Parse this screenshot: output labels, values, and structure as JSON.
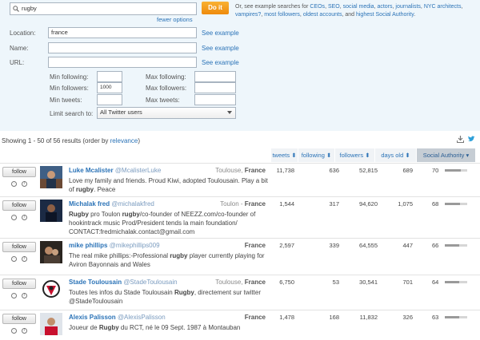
{
  "search": {
    "query": "rugby",
    "do_it_label": "Do it",
    "fewer_options": "fewer options",
    "help_prefix": "Or, see example searches for ",
    "help_links": [
      "CEOs",
      "SEO",
      "social media",
      "actors",
      "journalists",
      "NYC architects",
      "vampires?",
      "most followers",
      "oldest accounts"
    ],
    "help_and": "and ",
    "help_last": "highest Social Authority",
    "help_suffix": "."
  },
  "filters": {
    "location_label": "Location:",
    "location_value": "france",
    "name_label": "Name:",
    "url_label": "URL:",
    "see_example": "See example",
    "min_following_label": "Min following:",
    "max_following_label": "Max following:",
    "min_followers_label": "Min followers:",
    "min_followers_value": "1000",
    "max_followers_label": "Max followers:",
    "min_tweets_label": "Min tweets:",
    "max_tweets_label": "Max tweets:",
    "limit_label": "Limit search to:",
    "limit_value": "All Twitter users"
  },
  "results": {
    "summary_prefix": "Showing 1 - 50 of 56 results (order by ",
    "order_by": "relevance",
    "summary_suffix": ")",
    "columns": [
      "tweets",
      "following",
      "followers",
      "days old",
      "Social Authority"
    ],
    "follow_label": "follow",
    "rows": [
      {
        "name": "Luke Mcalister",
        "handle": "@McalisterLuke",
        "city": "Toulouse, ",
        "country": "France",
        "bio": "Love my family and friends. Proud Kiwi, adopted Toulousain. Play a bit of rugby. Peace",
        "tweets": "11,738",
        "following": "636",
        "followers": "52,815",
        "days_old": "689",
        "sa": "70",
        "sa_level": 0.7
      },
      {
        "name": "Michalak fred",
        "handle": "@michalakfred",
        "city": "Toulon - ",
        "country": "France",
        "bio": "Rugby pro Toulon rugby/co-founder of NEEZZ.com/co-founder of hookintrack music Prod/President tends la main foundation/ CONTACT:fredmichalak.contact@gmail.com",
        "tweets": "1,544",
        "following": "317",
        "followers": "94,620",
        "days_old": "1,075",
        "sa": "68",
        "sa_level": 0.68
      },
      {
        "name": "mike phillips",
        "handle": "@mikephillips009",
        "city": "",
        "country": "France",
        "bio": "The real mike phillips:-Professional rugby player currently playing for Aviron Bayonnais and Wales",
        "tweets": "2,597",
        "following": "339",
        "followers": "64,555",
        "days_old": "447",
        "sa": "66",
        "sa_level": 0.66
      },
      {
        "name": "Stade Toulousain",
        "handle": "@StadeToulousain",
        "city": "Toulouse, ",
        "country": "France",
        "bio": "Toutes les infos du Stade Toulousain Rugby, directement sur twitter @StadeToulousain",
        "tweets": "6,750",
        "following": "53",
        "followers": "30,541",
        "days_old": "701",
        "sa": "64",
        "sa_level": 0.64
      },
      {
        "name": "Alexis Palisson",
        "handle": "@AlexisPalisson",
        "city": "",
        "country": "France",
        "bio": "Joueur de Rugby du RCT, né le 09 Sept. 1987 à Montauban",
        "tweets": "1,478",
        "following": "168",
        "followers": "11,832",
        "days_old": "326",
        "sa": "63",
        "sa_level": 0.63
      }
    ]
  },
  "icons": [
    "search-icon",
    "download-icon",
    "twitter-bird-icon",
    "sort-arrows-icon",
    "eye-off-icon",
    "block-icon",
    "chevron-down-icon"
  ],
  "colors": {
    "accent": "#2b73b7",
    "doit": "#f39c12",
    "panel": "#eef6fb"
  }
}
